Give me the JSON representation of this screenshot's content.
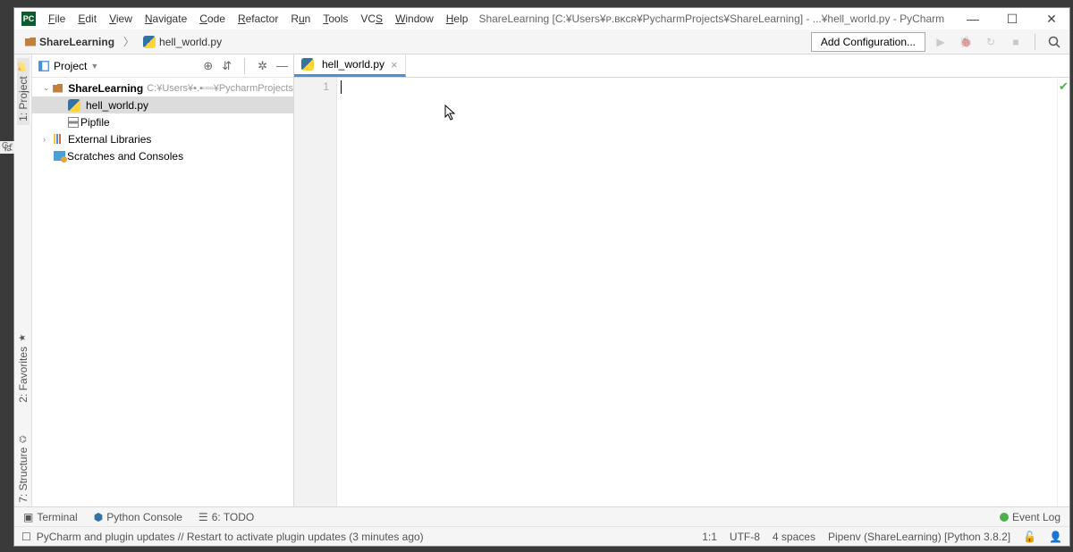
{
  "title_path": "ShareLearning [C:¥Users¥ᴘ.ʙᴋᴄʀ¥PycharmProjects¥ShareLearning] - ...¥hell_world.py - PyCharm",
  "menu": [
    "File",
    "Edit",
    "View",
    "Navigate",
    "Code",
    "Refactor",
    "Run",
    "Tools",
    "VCS",
    "Window",
    "Help"
  ],
  "breadcrumb": {
    "project": "ShareLearning",
    "file": "hell_world.py"
  },
  "add_config": "Add Configuration...",
  "side_tabs": {
    "project": "1: Project",
    "favorites": "2: Favorites",
    "structure": "7: Structure"
  },
  "panel": {
    "title": "Project",
    "tree": {
      "root": "ShareLearning",
      "root_path": "C:¥Users¥▪.▪▫▫▫¥PycharmProjects",
      "file1": "hell_world.py",
      "file2": "Pipfile",
      "ext_lib": "External Libraries",
      "scratches": "Scratches and Consoles"
    }
  },
  "editor_tab": "hell_world.py",
  "gutter_line": "1",
  "bottom": {
    "terminal": "Terminal",
    "pyconsole": "Python Console",
    "todo": "6: TODO",
    "event_log": "Event Log"
  },
  "status": {
    "msg": "PyCharm and plugin updates // Restart to activate plugin updates (3 minutes ago)",
    "pos": "1:1",
    "encoding": "UTF-8",
    "indent": "4 spaces",
    "interpreter": "Pipenv (ShareLearning) [Python 3.8.2]"
  },
  "ime": "ば"
}
